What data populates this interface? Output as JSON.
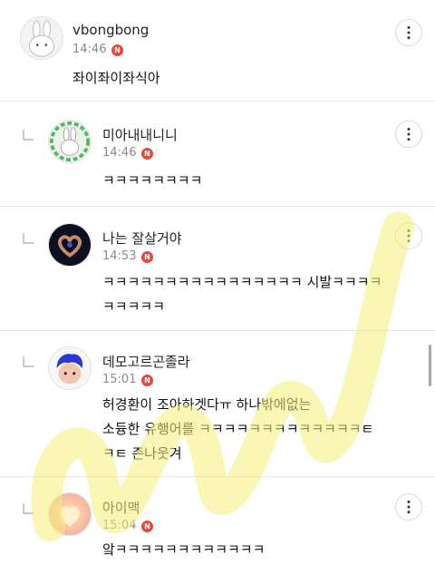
{
  "comments": [
    {
      "nickname": "vbongbong",
      "time": "14:46",
      "badge": "N",
      "text": "좌이좌이좌식아",
      "avatar": "white-rabbit-avatar"
    },
    {
      "nickname": "미아내내니니",
      "time": "14:46",
      "badge": "N",
      "text": "ㅋㅋㅋㅋㅋㅋㅋㅋ",
      "avatar": "rabbit-green-frame-avatar"
    },
    {
      "nickname": "나는 잘살거야",
      "time": "14:53",
      "badge": "N",
      "text": "ㅋㅋㅋㅋㅋㅋㅋㅋㅋㅋㅋㅋㅋㅋㅋㅋ 시발ㅋㅋㅋㅋ\nㅋㅋㅋㅋㅋ",
      "avatar": "heart-hands-avatar"
    },
    {
      "nickname": "데모고르곤졸라",
      "time": "15:01",
      "badge": "N",
      "text": "허경환이 조아하겟다ㅠ 하나밖에없는\n소듕한 유행어를 ㅋㅋㅋㅋㅋㅋㅋㅋㅋㅋㅋㅋㅋㅌ\nㅋㅌ 존나웃겨",
      "avatar": "blue-hair-character-avatar"
    },
    {
      "nickname": "아이맥",
      "time": "15:04",
      "badge": "N",
      "text": "앜ㅋㅋㅋㅋㅋㅋㅋㅋㅋㅋㅋㅋ",
      "avatar": "pastel-heart-avatar"
    }
  ],
  "icons": {
    "more": "more-options-icon",
    "reply": "reply-arrow-icon"
  },
  "colors": {
    "badge": "#e8483b",
    "highlight": "#f6ee7a"
  }
}
